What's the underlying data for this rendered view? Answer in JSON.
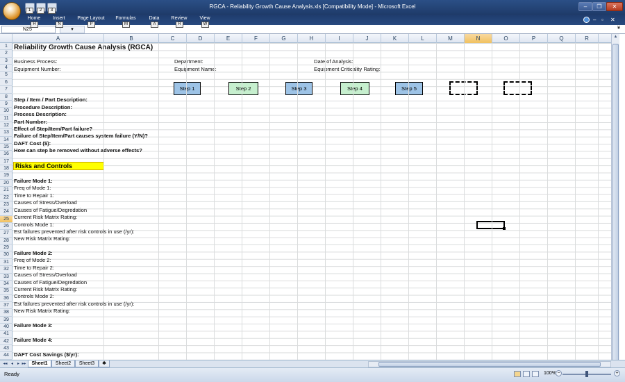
{
  "window": {
    "title": "RGCA - Reliability Growth Cause Analysis.xls  [Compatibility Mode] - Microsoft Excel",
    "minimize": "–",
    "restore": "❐",
    "close": "✕"
  },
  "quick_access": {
    "keytips": [
      "1",
      "2",
      "3"
    ]
  },
  "ribbon": {
    "tabs": [
      {
        "label": "Home",
        "keytip": "H"
      },
      {
        "label": "Insert",
        "keytip": "N"
      },
      {
        "label": "Page Layout",
        "keytip": "P"
      },
      {
        "label": "Formulas",
        "keytip": "M"
      },
      {
        "label": "Data",
        "keytip": "A"
      },
      {
        "label": "Review",
        "keytip": "R"
      },
      {
        "label": "View",
        "keytip": "W"
      }
    ],
    "help_icon": "help-icon",
    "min": "–",
    "restore": "▫",
    "close": "✕"
  },
  "formula_bar": {
    "name_box": "N25",
    "fx_label": "▾",
    "expand": "¥"
  },
  "columns": [
    "A",
    "B",
    "C",
    "D",
    "E",
    "F",
    "G",
    "H",
    "I",
    "J",
    "K",
    "L",
    "M",
    "N",
    "O",
    "P",
    "Q",
    "R"
  ],
  "selected_column": "N",
  "selected_row": "25",
  "rows": [
    "1",
    "2",
    "3",
    "4",
    "5",
    "6",
    "7",
    "8",
    "9",
    "10",
    "11",
    "12",
    "13",
    "14",
    "15",
    "16",
    "17",
    "18",
    "19",
    "20",
    "21",
    "22",
    "23",
    "24",
    "25",
    "26",
    "27",
    "28",
    "29",
    "30",
    "31",
    "32",
    "33",
    "34",
    "35",
    "36",
    "37",
    "38",
    "39",
    "40",
    "41",
    "42",
    "43",
    "44"
  ],
  "sheet": {
    "title": "Reliability Growth Cause Analysis (RGCA)",
    "business_process": "Business Process:",
    "equipment_number": "Equipment Number:",
    "department": "Department:",
    "equipment_name": "Equipment Name:",
    "date_of_analysis": "Date of Analysis:",
    "equipment_criticality": "Equipment Criticality Rating:",
    "steps": [
      "Step 1",
      "Step 2",
      "Step 3",
      "Step 4",
      "Step 5"
    ],
    "step_colors": [
      "#9dc3e6",
      "#c6efce",
      "#9dc3e6",
      "#c6efce",
      "#9dc3e6"
    ],
    "desc_rows": [
      "Step / Item / Part Description:",
      "Procedure Description:",
      "Process Description:",
      "Part Number:",
      "Effect of Step/Item/Part failure?",
      "Failure of Step/Item/Part causes system failure (Y/N)?",
      "DAFT Cost ($):",
      "How can step be removed without adverse effects?"
    ],
    "risks_and_controls": "Risks and Controls",
    "risks_fill_color": "#ffff00",
    "failure_mode_1": {
      "heading": "Failure Mode 1:",
      "items": [
        "Freq of Mode 1:",
        "Time to Repair 1:",
        "Causes of Stress/Overload",
        "Causes of Fatigue/Degredation",
        "Current Risk Matrix Rating:",
        "Controls Mode 1:",
        "Est failures prevented after risk controls in use (/yr):",
        "New Risk Matrix Rating:"
      ]
    },
    "failure_mode_2": {
      "heading": "Failure Mode 2:",
      "items": [
        "Freq of Mode 2:",
        "Time to Repair 2:",
        "Causes of Stress/Overload",
        "Causes of Fatigue/Degredation",
        "Current Risk Matrix Rating:",
        "Controls Mode 2:",
        "Est failures prevented after risk controls in use (/yr):",
        "New Risk Matrix Rating:"
      ]
    },
    "failure_mode_3": "Failure Mode 3:",
    "failure_mode_4": "Failure Mode 4:",
    "daft_cost_savings": "DAFT Cost Savings ($/yr):"
  },
  "sheet_tabs": [
    "Sheet1",
    "Sheet2",
    "Sheet3"
  ],
  "active_sheet": "Sheet1",
  "nav": [
    "◂◂",
    "◂",
    "▸",
    "▸▸"
  ],
  "status": {
    "ready": "Ready",
    "zoom": "100%",
    "zoom_out": "−",
    "zoom_in": "+"
  }
}
